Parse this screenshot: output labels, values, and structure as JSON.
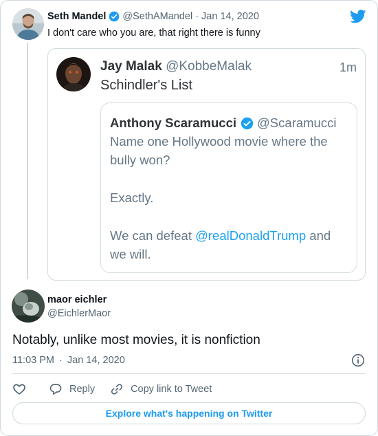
{
  "parent_tweet": {
    "name": "Seth Mandel",
    "handle": "@SethAMandel",
    "separator": "·",
    "date": "Jan 14, 2020",
    "text": "I don't care who you are, that right there is funny",
    "verified": true
  },
  "screenshot": {
    "name": "Jay Malak",
    "handle": "@KobbeMalak",
    "time": "1m",
    "text": "Schindler's List",
    "quote": {
      "name": "Anthony Scaramucci",
      "handle": "@Scaramucci",
      "verified": true,
      "line1": "Name one Hollywood movie where the",
      "line2": "bully won?",
      "line3": "Exactly.",
      "line4_prefix": "We can defeat",
      "line4_mention": "@realDonaldTrump",
      "line4_suffix": "and",
      "line5": "we will."
    }
  },
  "tweet": {
    "name": "maor eichler",
    "handle": "@EichlerMaor",
    "text": "Notably, unlike most movies, it is nonfiction",
    "time": "11:03 PM",
    "separator": "·",
    "date": "Jan 14, 2020"
  },
  "actions": {
    "reply_label": "Reply",
    "copy_label": "Copy link to Tweet"
  },
  "cta_label": "Explore what's happening on Twitter",
  "colors": {
    "accent": "#1d9bf0",
    "text": "#0f1419",
    "muted": "#536471",
    "border": "#cfd9de"
  },
  "icons": [
    "twitter-logo-icon",
    "verified-badge-icon",
    "info-icon",
    "like-heart-icon",
    "reply-bubble-icon",
    "link-icon"
  ]
}
